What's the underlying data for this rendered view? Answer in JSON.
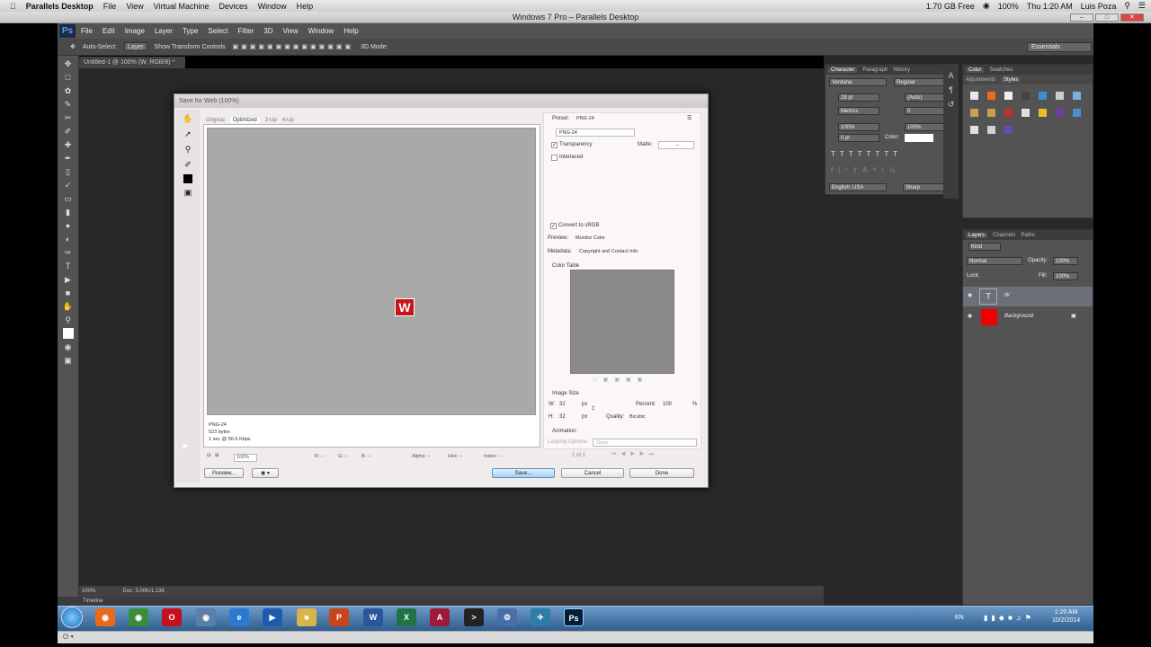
{
  "mac_menu": {
    "app": "Parallels Desktop",
    "items": [
      "File",
      "View",
      "Virtual Machine",
      "Devices",
      "Window",
      "Help"
    ]
  },
  "mac_status": {
    "disk": "1.70 GB Free",
    "battery": "100%",
    "clock": "Thu 1:20 AM",
    "user": "Luis Poza"
  },
  "window_title": "Windows 7 Pro – Parallels Desktop",
  "ps_menu": {
    "logo": "Ps",
    "items": [
      "File",
      "Edit",
      "Image",
      "Layer",
      "Type",
      "Select",
      "Filter",
      "3D",
      "View",
      "Window",
      "Help"
    ]
  },
  "ps_options": {
    "auto_select": "Auto-Select:",
    "layer": "Layer",
    "transform": "Show Transform Controls",
    "mode3d": "3D Mode:",
    "workspace": "Essentials"
  },
  "doc_tab": "Untitled-1 @ 100% (W, RGB/8) *",
  "status": {
    "zoom": "100%",
    "doc": "Doc: 3.00K/1.13K",
    "timeline": "Timeline"
  },
  "character": {
    "tabs": [
      "Character",
      "Paragraph",
      "History"
    ],
    "font": "Verdana",
    "style": "Regular",
    "size": "28 pt",
    "leading": "(Auto)",
    "kerning": "Metrics",
    "tracking": "0",
    "vscale": "100%",
    "hscale": "100%",
    "baseline": "0 pt",
    "color_label": "Color:",
    "language": "English: USA",
    "aa": "Sharp"
  },
  "color_panel": {
    "tabs": [
      "Color",
      "Swatches"
    ],
    "subtabs": [
      "Adjustments",
      "Styles"
    ]
  },
  "layers": {
    "tabs": [
      "Layers",
      "Channels",
      "Paths"
    ],
    "kind": "Kind",
    "blend": "Normal",
    "opacity_label": "Opacity:",
    "opacity": "100%",
    "lock_label": "Lock:",
    "fill_label": "Fill:",
    "fill": "100%",
    "items": [
      {
        "name": "W"
      },
      {
        "name": "Background"
      }
    ]
  },
  "dialog": {
    "title": "Save for Web (100%)",
    "tabs": [
      "Original",
      "Optimized",
      "2-Up",
      "4-Up"
    ],
    "preview_letter": "W",
    "info": [
      "PNG-24",
      "523 bytes",
      "1 sec @ 56.6 Kbps"
    ],
    "readouts": [
      "100%",
      "R: --",
      "G: --",
      "B: --",
      "Alpha: --",
      "Hex: --",
      "Index: --"
    ],
    "preset_label": "Preset:",
    "preset": "PNG-24",
    "format": "PNG-24",
    "transparency": "Transparency",
    "matte_label": "Matte:",
    "matte": "--",
    "interlaced": "Interlaced",
    "convert": "Convert to sRGB",
    "preview_label": "Preview:",
    "preview_val": "Monitor Color",
    "metadata_label": "Metadata:",
    "metadata_val": "Copyright and Contact Info",
    "color_table": "Color Table",
    "image_size": "Image Size",
    "w_label": "W:",
    "w": "32",
    "h_label": "H:",
    "h": "32",
    "px": "px",
    "percent_label": "Percent:",
    "percent": "100",
    "pct": "%",
    "quality_label": "Quality:",
    "quality": "Bicubic",
    "animation": "Animation",
    "looping_label": "Looping Options:",
    "looping": "Once",
    "frames": "1 of 1",
    "buttons": {
      "preview": "Preview...",
      "save": "Save...",
      "cancel": "Cancel",
      "done": "Done"
    }
  },
  "taskbar": {
    "lang": "EN",
    "time": "1:20 AM",
    "date": "10/2/2014"
  }
}
